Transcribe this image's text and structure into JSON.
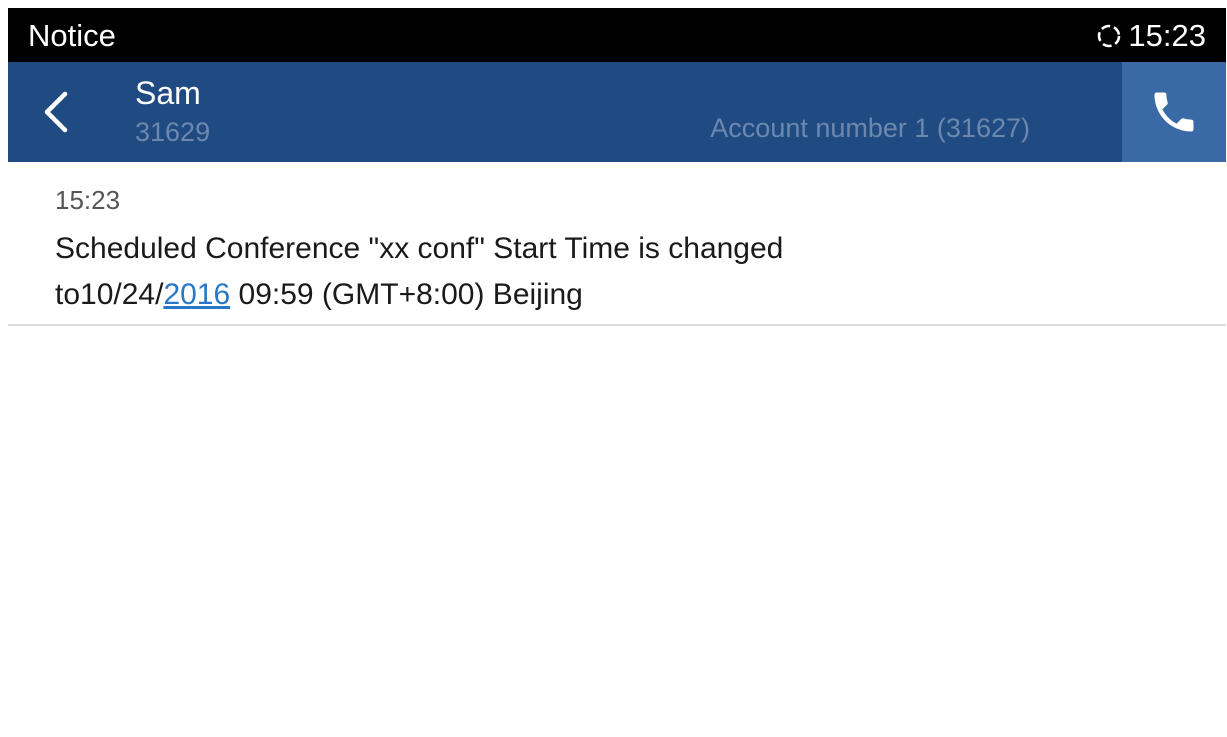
{
  "status_bar": {
    "title": "Notice",
    "icon": "sync-icon",
    "time": "15:23"
  },
  "header": {
    "back_icon": "chevron-left-icon",
    "contact_name": "Sam",
    "contact_number": "31629",
    "account": "Account number 1 (31627)",
    "call_icon": "phone-icon"
  },
  "message": {
    "time": "15:23",
    "text_line1": "Scheduled Conference \"xx conf\" Start Time is changed",
    "text_before_link": "to10/24/",
    "link_text": "2016",
    "text_after_link": " 09:59 (GMT+8:00) Beijing"
  },
  "colors": {
    "status_bar": "#000000",
    "header": "#1f4a82",
    "call_button": "#3a6aa6",
    "muted_text": "#6d88ad",
    "link": "#2a77c9"
  }
}
